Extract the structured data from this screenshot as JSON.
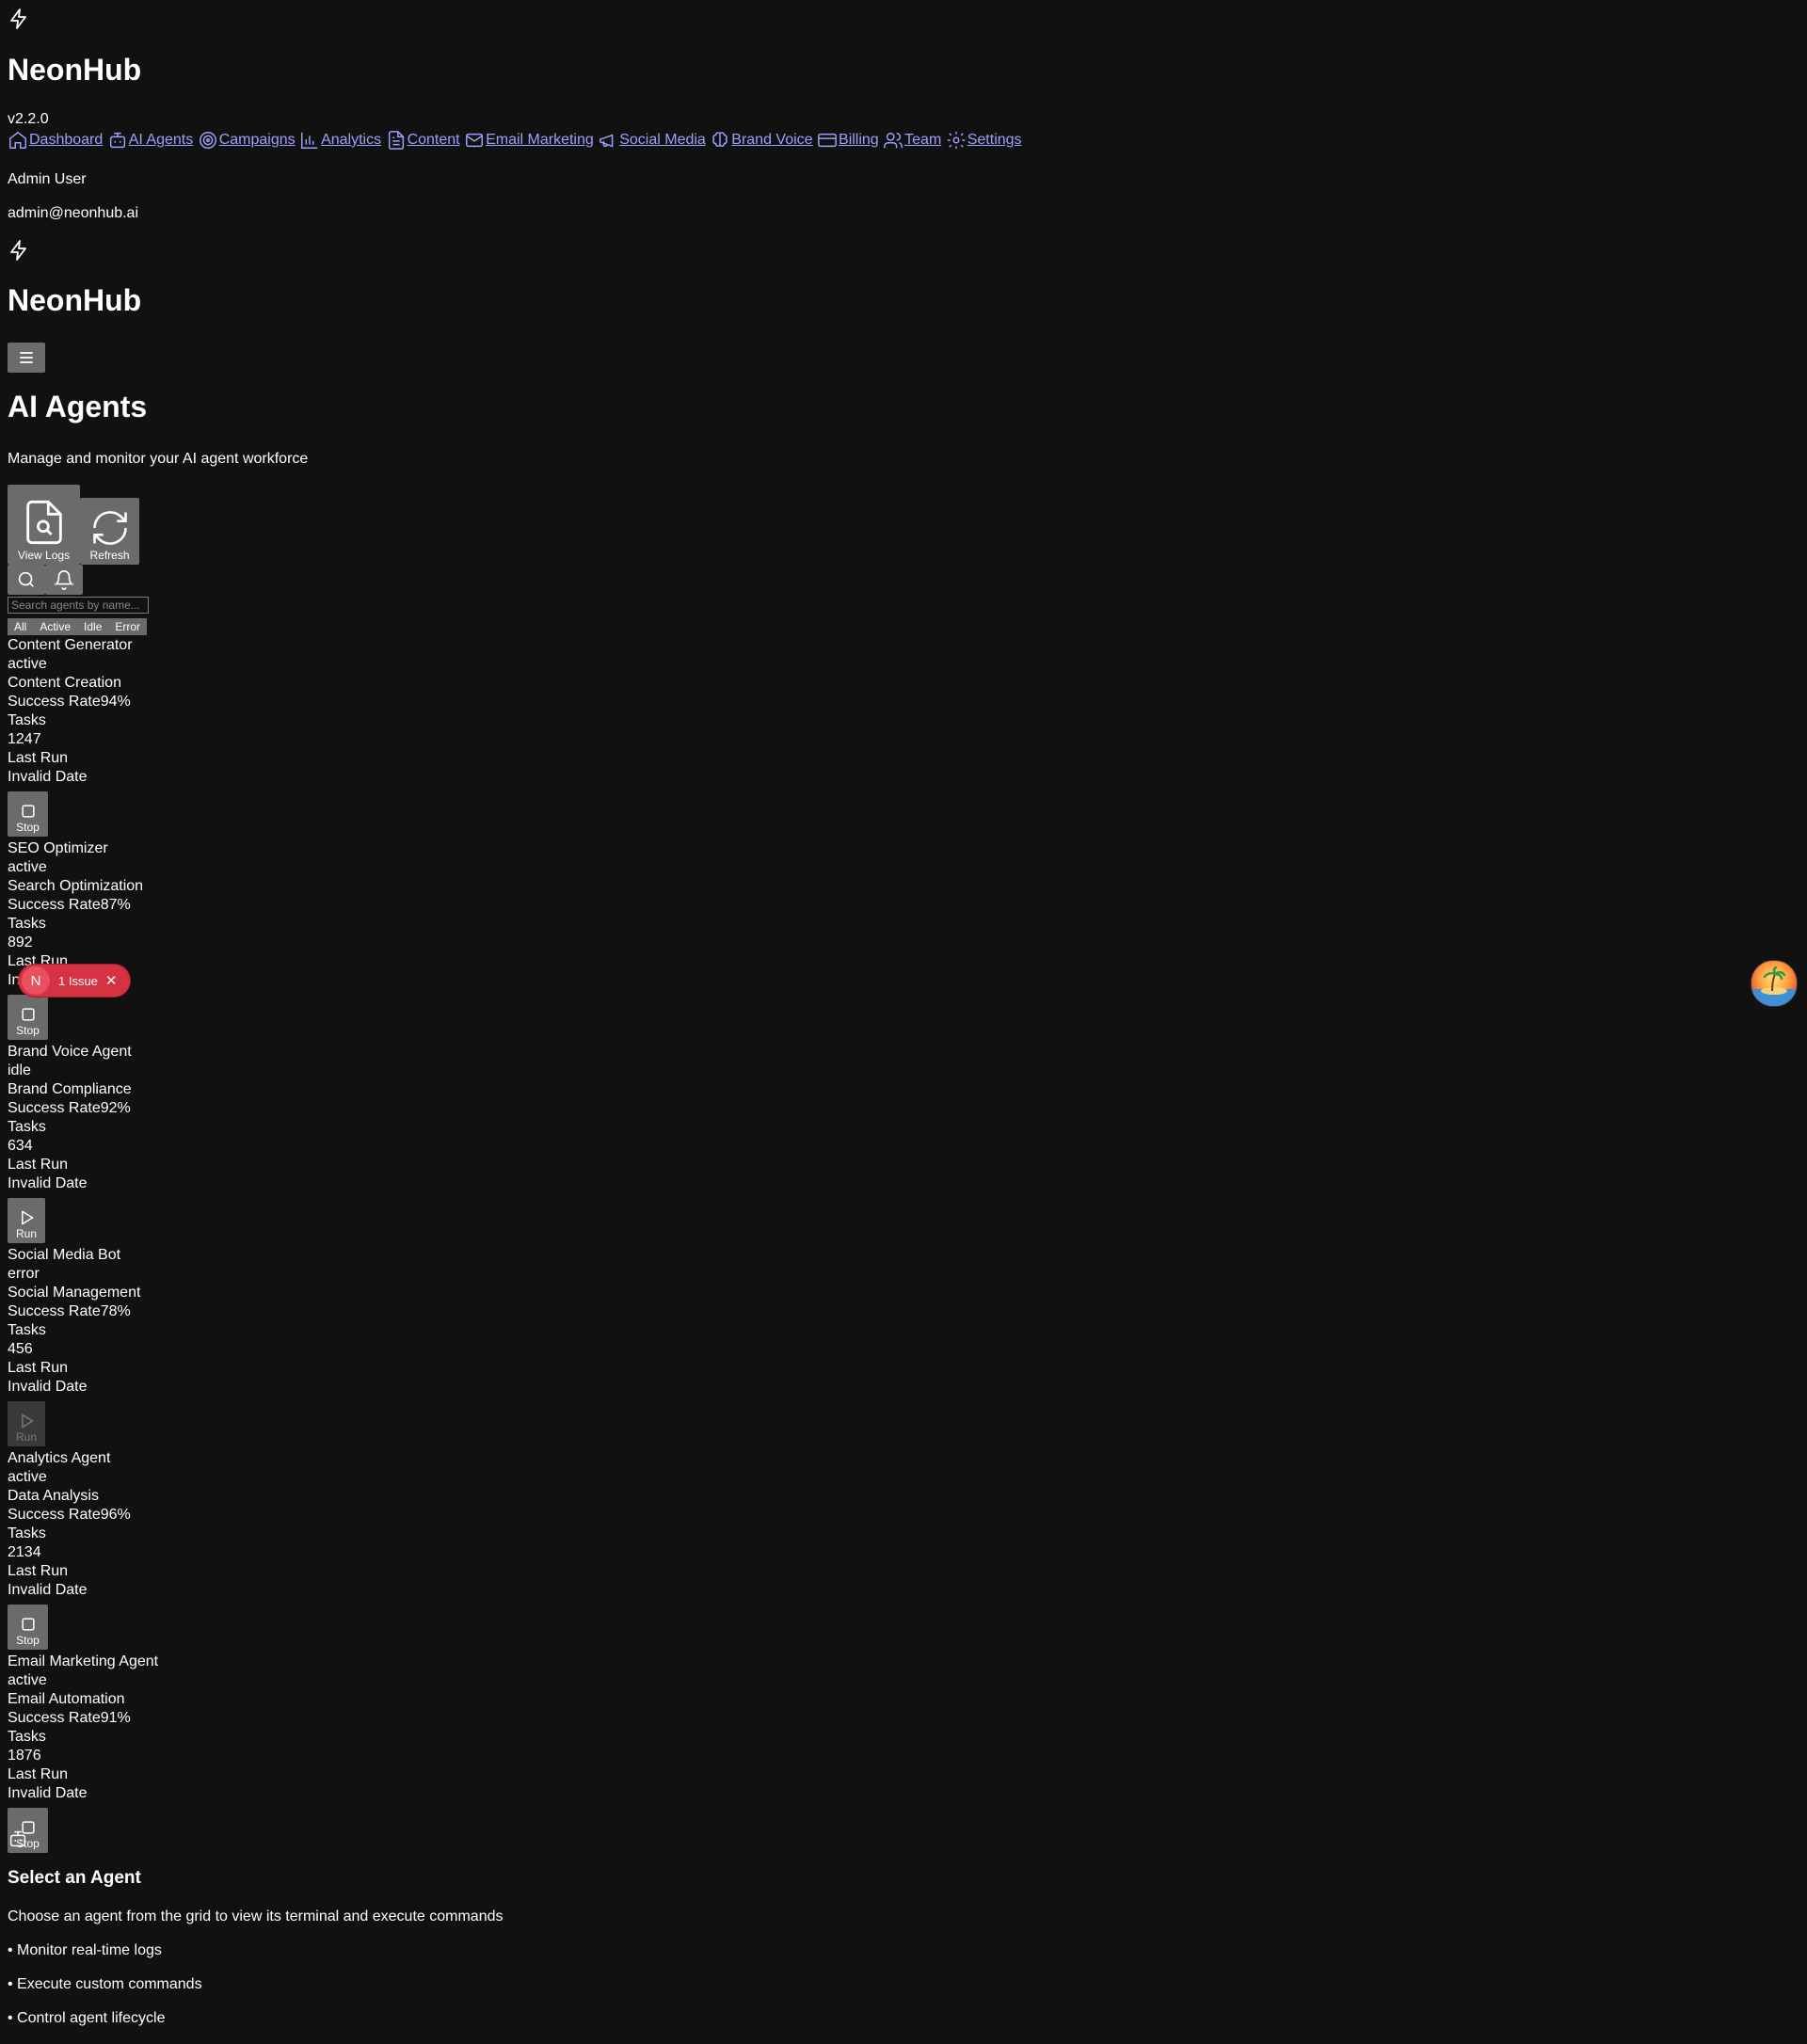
{
  "app": {
    "name": "NeonHub",
    "version": "v2.2.0"
  },
  "nav": {
    "items": [
      {
        "label": "Dashboard",
        "icon": "home-icon"
      },
      {
        "label": "AI Agents",
        "icon": "bot-icon"
      },
      {
        "label": "Campaigns",
        "icon": "target-icon"
      },
      {
        "label": "Analytics",
        "icon": "bar-chart-icon"
      },
      {
        "label": "Content",
        "icon": "file-text-icon"
      },
      {
        "label": "Email Marketing",
        "icon": "mail-icon"
      },
      {
        "label": "Social Media",
        "icon": "megaphone-icon"
      },
      {
        "label": "Brand Voice",
        "icon": "brain-icon"
      },
      {
        "label": "Billing",
        "icon": "credit-card-icon"
      },
      {
        "label": "Team",
        "icon": "users-icon"
      },
      {
        "label": "Settings",
        "icon": "gear-icon"
      }
    ]
  },
  "user": {
    "name": "Admin User",
    "email": "admin@neonhub.ai"
  },
  "page": {
    "title": "AI Agents",
    "subtitle": "Manage and monitor your AI agent workforce"
  },
  "toolbar": {
    "view_logs": "View Logs",
    "refresh": "Refresh"
  },
  "search": {
    "placeholder": "Search agents by name..."
  },
  "filters": [
    "All",
    "Active",
    "Idle",
    "Error"
  ],
  "agents": [
    {
      "name": "Content Generator",
      "status": "active",
      "type": "Content Creation",
      "success_label": "Success Rate",
      "success": "94%",
      "tasks_label": "Tasks",
      "tasks": "1247",
      "last_run_label": "Last Run",
      "last_run": "Invalid Date",
      "action": "Stop"
    },
    {
      "name": "SEO Optimizer",
      "status": "active",
      "type": "Search Optimization",
      "success_label": "Success Rate",
      "success": "87%",
      "tasks_label": "Tasks",
      "tasks": "892",
      "last_run_label": "Last Run",
      "last_run": "Invalid Date",
      "action": "Stop"
    },
    {
      "name": "Brand Voice Agent",
      "status": "idle",
      "type": "Brand Compliance",
      "success_label": "Success Rate",
      "success": "92%",
      "tasks_label": "Tasks",
      "tasks": "634",
      "last_run_label": "Last Run",
      "last_run": "Invalid Date",
      "action": "Run"
    },
    {
      "name": "Social Media Bot",
      "status": "error",
      "type": "Social Management",
      "success_label": "Success Rate",
      "success": "78%",
      "tasks_label": "Tasks",
      "tasks": "456",
      "last_run_label": "Last Run",
      "last_run": "Invalid Date",
      "action": "Run"
    },
    {
      "name": "Analytics Agent",
      "status": "active",
      "type": "Data Analysis",
      "success_label": "Success Rate",
      "success": "96%",
      "tasks_label": "Tasks",
      "tasks": "2134",
      "last_run_label": "Last Run",
      "last_run": "Invalid Date",
      "action": "Stop"
    },
    {
      "name": "Email Marketing Agent",
      "status": "active",
      "type": "Email Automation",
      "success_label": "Success Rate",
      "success": "91%",
      "tasks_label": "Tasks",
      "tasks": "1876",
      "last_run_label": "Last Run",
      "last_run": "Invalid Date",
      "action": "Stop"
    }
  ],
  "empty_state": {
    "title": "Select an Agent",
    "subtitle": "Choose an agent from the grid to view its terminal and execute commands",
    "bullets": [
      "• Monitor real-time logs",
      "• Execute custom commands",
      "• Control agent lifecycle"
    ]
  },
  "issues_badge": {
    "letter": "N",
    "label": "1 Issue",
    "close": "✕"
  },
  "colors": {
    "background": "#111111",
    "link": "#9f9fff",
    "button": "#6b6b6b",
    "issue": "#d63242"
  }
}
